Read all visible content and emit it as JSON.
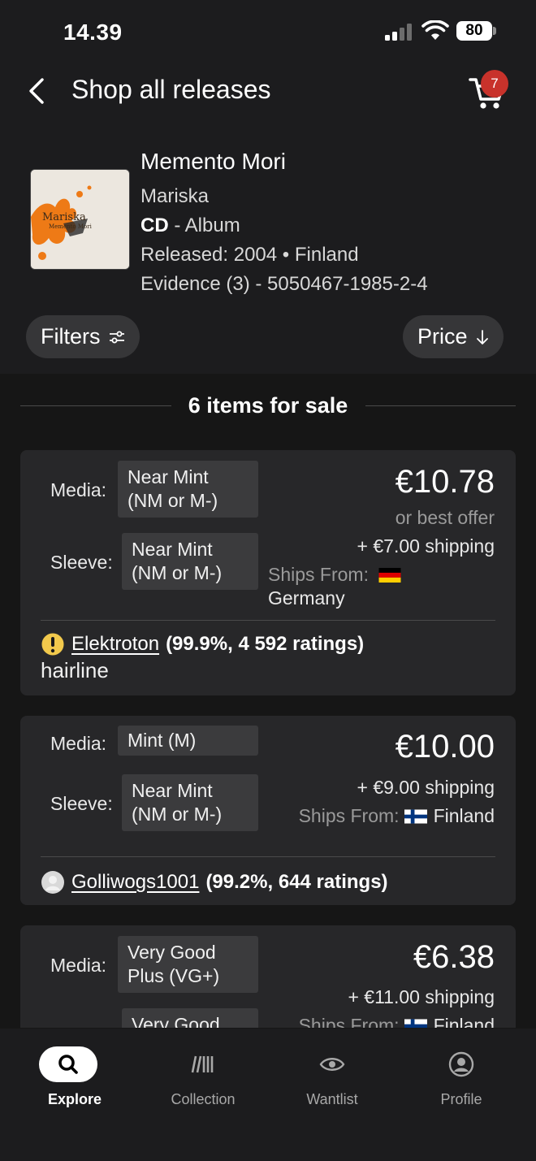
{
  "status_bar": {
    "time": "14.39",
    "battery": "80"
  },
  "header": {
    "title": "Shop all releases",
    "cart_count": "7"
  },
  "release": {
    "title": "Memento Mori",
    "artist": "Mariska",
    "format_bold": "CD",
    "format_rest": " - Album",
    "released": "Released: 2004 • Finland",
    "catalog": "Evidence (3) - 5050467-1985-2-4",
    "cover_text_1": "Mariska",
    "cover_text_2": "Memento Mori"
  },
  "controls": {
    "filters_label": "Filters",
    "sort_label": "Price"
  },
  "listing_count": "6 items for sale",
  "labels": {
    "media": "Media:",
    "sleeve": "Sleeve:",
    "ships_from": "Ships From:"
  },
  "listings": [
    {
      "media": "Near Mint (NM or M-)",
      "sleeve": "Near Mint (NM or M-)",
      "price": "€10.78",
      "offer": "or best offer",
      "shipping": "+ €7.00 shipping",
      "country": "Germany",
      "seller": "Elektroton",
      "seller_stats": "(99.9%, 4 592 ratings)",
      "comment": "hairline"
    },
    {
      "media": "Mint (M)",
      "sleeve": "Near Mint (NM or M-)",
      "price": "€10.00",
      "shipping": "+ €9.00 shipping",
      "country": "Finland",
      "seller": "Golliwogs1001",
      "seller_stats": "(99.2%, 644 ratings)"
    },
    {
      "media": "Very Good Plus (VG+)",
      "sleeve": "Very Good",
      "price": "€6.38",
      "shipping": "+ €11.00 shipping",
      "country": "Finland"
    }
  ],
  "tabs": [
    {
      "label": "Explore",
      "icon": "search-icon"
    },
    {
      "label": "Collection",
      "icon": "collection-icon"
    },
    {
      "label": "Wantlist",
      "icon": "eye-icon"
    },
    {
      "label": "Profile",
      "icon": "profile-icon"
    }
  ],
  "colors": {
    "background": "#161616",
    "card": "#272729",
    "grade_chip": "#3b3b3d",
    "badge": "#c8322b"
  }
}
